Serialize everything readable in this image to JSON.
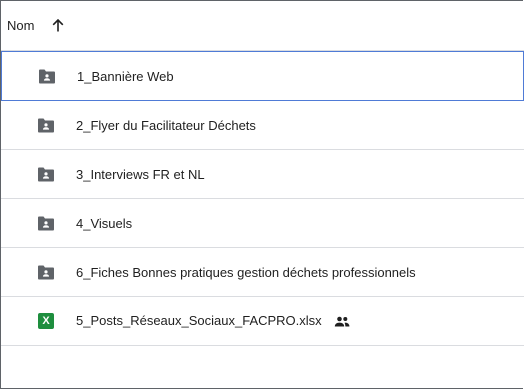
{
  "header": {
    "column_label": "Nom",
    "sort_icon": "arrow-up-icon"
  },
  "files": [
    {
      "name": "1_Bannière Web",
      "type": "shared-folder",
      "icon": "shared-folder-icon",
      "selected": true
    },
    {
      "name": "2_Flyer du Facilitateur Déchets",
      "type": "shared-folder",
      "icon": "shared-folder-icon",
      "selected": false
    },
    {
      "name": "3_Interviews FR et NL",
      "type": "shared-folder",
      "icon": "shared-folder-icon",
      "selected": false
    },
    {
      "name": "4_Visuels",
      "type": "shared-folder",
      "icon": "shared-folder-icon",
      "selected": false
    },
    {
      "name": "6_Fiches Bonnes pratiques gestion déchets professionnels",
      "type": "shared-folder",
      "icon": "shared-folder-icon",
      "selected": false
    },
    {
      "name": "5_Posts_Réseaux_Sociaux_FACPRO.xlsx",
      "type": "spreadsheet",
      "icon": "excel-file-icon",
      "badge_letter": "X",
      "shared": true,
      "shared_icon": "people-icon"
    }
  ],
  "colors": {
    "folder_icon": "#5f6368",
    "excel_badge": "#1e8e3e",
    "selection_border": "#4f7bd6",
    "divider": "#dadce0"
  }
}
